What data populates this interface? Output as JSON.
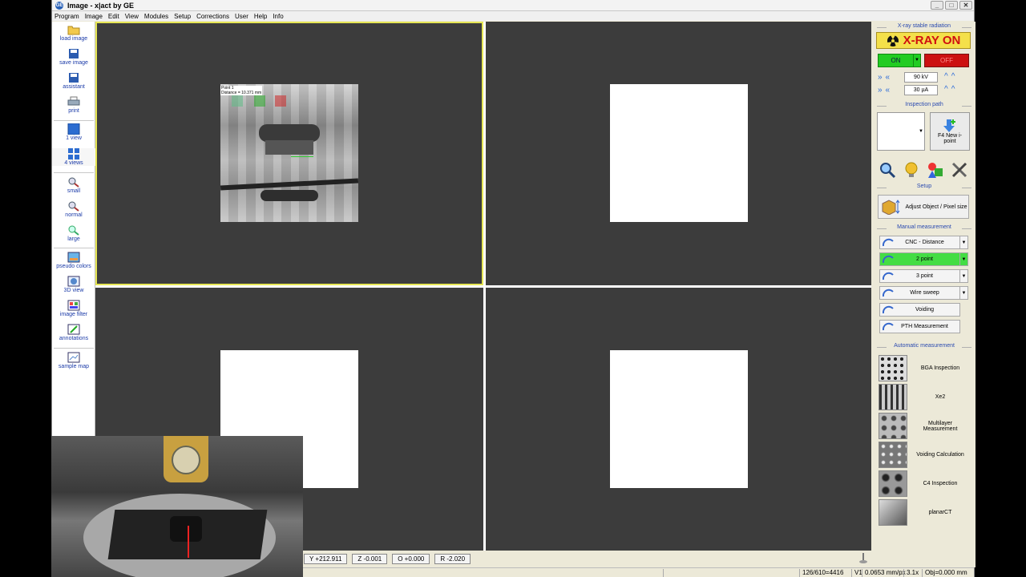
{
  "window": {
    "title": "Image - x|act by GE",
    "min": "_",
    "max": "□",
    "close": "✕"
  },
  "menu": [
    "Program",
    "Image",
    "Edit",
    "View",
    "Modules",
    "Setup",
    "Corrections",
    "User",
    "Help",
    "Info"
  ],
  "toolbar": {
    "load": "load image",
    "save": "save image",
    "assistant": "assistant",
    "print": "print",
    "view1": "1 view",
    "view4": "4 views",
    "small": "small",
    "normal": "normal",
    "large": "large",
    "pseudo": "pseudo colors",
    "view3d": "3D view",
    "filter": "image filter",
    "annotations": "annotations",
    "samplemap": "sample map"
  },
  "xray": {
    "section": "X-ray stable radiation",
    "status": "X-RAY ON",
    "on": "ON",
    "off": "OFF",
    "kv": "90 kV",
    "ua": "30 µA"
  },
  "inspection": {
    "section": "Inspection path",
    "new_label": "F4 New i-point"
  },
  "setup": {
    "section": "Setup",
    "adjust": "Adjust Object / Pixel size"
  },
  "manual": {
    "section": "Manual measurement",
    "items": [
      "CNC - Distance",
      "2 point",
      "3 point",
      "Wire sweep",
      "Voiding",
      "PTH Measurement"
    ]
  },
  "automatic": {
    "section": "Automatic measurement",
    "items": [
      "BGA Inspection",
      "Xe2",
      "Multilayer Measurement",
      "Voiding Calculation",
      "C4 Inspection",
      "planarCT"
    ]
  },
  "coords": {
    "y": "Y +212.911",
    "z": "Z  -0.001",
    "o": "O  +0.000",
    "r": "R  -2.020"
  },
  "status": {
    "pixels": "126/610=4416",
    "v": "V1",
    "scale": "0.0653 mm/px",
    "zoom": "3.1x",
    "obj": "Obj=0.000 mm"
  },
  "xray_overlay": {
    "line1": "Point 1",
    "line2": "Distance = 10.371 mm"
  },
  "colors": {
    "accent_yellow": "#e6e654",
    "on_green": "#22cc22",
    "off_red": "#cc1111",
    "active_green": "#44dd44"
  }
}
